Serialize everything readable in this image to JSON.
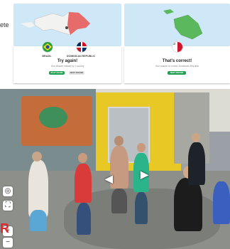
{
  "left_crop": {
    "text": "ete"
  },
  "results": {
    "left_card": {
      "flag_a_label": "BRAZIL",
      "flag_b_label": "DOMINICAN REPUBLIC",
      "title": "Try again!",
      "subtitle": "Your answer missed by 1 country",
      "primary_button": "PLAY AGAIN",
      "secondary_button": "NEXT ROUND"
    },
    "right_card": {
      "title": "That's correct!",
      "subtitle": "Your answer is correct: Dominican Republic",
      "primary_button": "NEXT ROUND"
    }
  },
  "street_view": {
    "controls": [
      "+",
      "−",
      "⛶"
    ],
    "logo": "R"
  },
  "colors": {
    "accent_green": "#21a04f",
    "country_red": "#e76b6b",
    "country_green": "#5cb85c",
    "map_sea": "#cfe8f7"
  }
}
